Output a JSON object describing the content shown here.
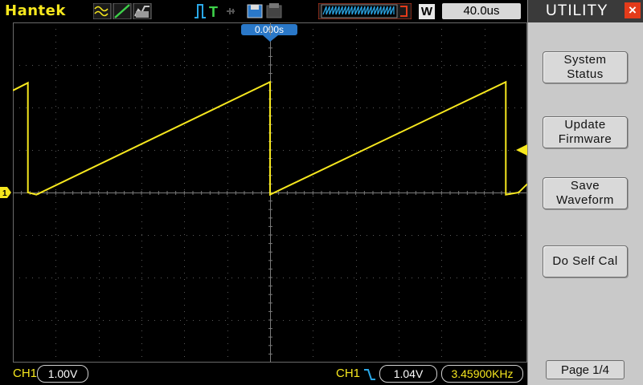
{
  "topbar": {
    "brand": "Hantek",
    "window_label": "W",
    "timebase": "40.0us",
    "trigger_position": "0.000s"
  },
  "bottombar": {
    "ch1_label": "CH1",
    "ch1_scale": "1.00V",
    "trigger_source": "CH1",
    "trigger_slope_icon": "falling-edge-icon",
    "trigger_level": "1.04V",
    "frequency": "3.45900KHz"
  },
  "menu": {
    "title": "UTILITY",
    "close_icon": "close-icon",
    "buttons": [
      {
        "line1": "System",
        "line2": "Status"
      },
      {
        "line1": "Update",
        "line2": "Firmware"
      },
      {
        "line1": "Save",
        "line2": "Waveform"
      },
      {
        "line1": "Do Self Cal",
        "line2": ""
      }
    ],
    "page": "Page 1/4"
  },
  "colors": {
    "trace": "#f6e71e",
    "grid": "#5a5a5a",
    "menu_bg": "#c9c9c9",
    "close_bg": "#e43b1a",
    "trigger_marker": "#2a78c8"
  },
  "chart_data": {
    "type": "line",
    "series": [
      {
        "values_div": [
          {
            "t": -6.0,
            "v": 2.4
          },
          {
            "t": -5.65,
            "v": 2.58
          },
          {
            "t": -5.65,
            "v": 0.0
          },
          {
            "t": -5.45,
            "v": -0.05
          },
          {
            "t": 0.0,
            "v": 2.6
          },
          {
            "t": 0.0,
            "v": -0.05
          },
          {
            "t": 5.5,
            "v": 2.6
          },
          {
            "t": 5.5,
            "v": -0.05
          },
          {
            "t": 5.8,
            "v": 0.0
          },
          {
            "t": 6.0,
            "v": 0.2
          }
        ]
      }
    ],
    "x_divisions": 12,
    "y_divisions": 8,
    "grid": true
  }
}
